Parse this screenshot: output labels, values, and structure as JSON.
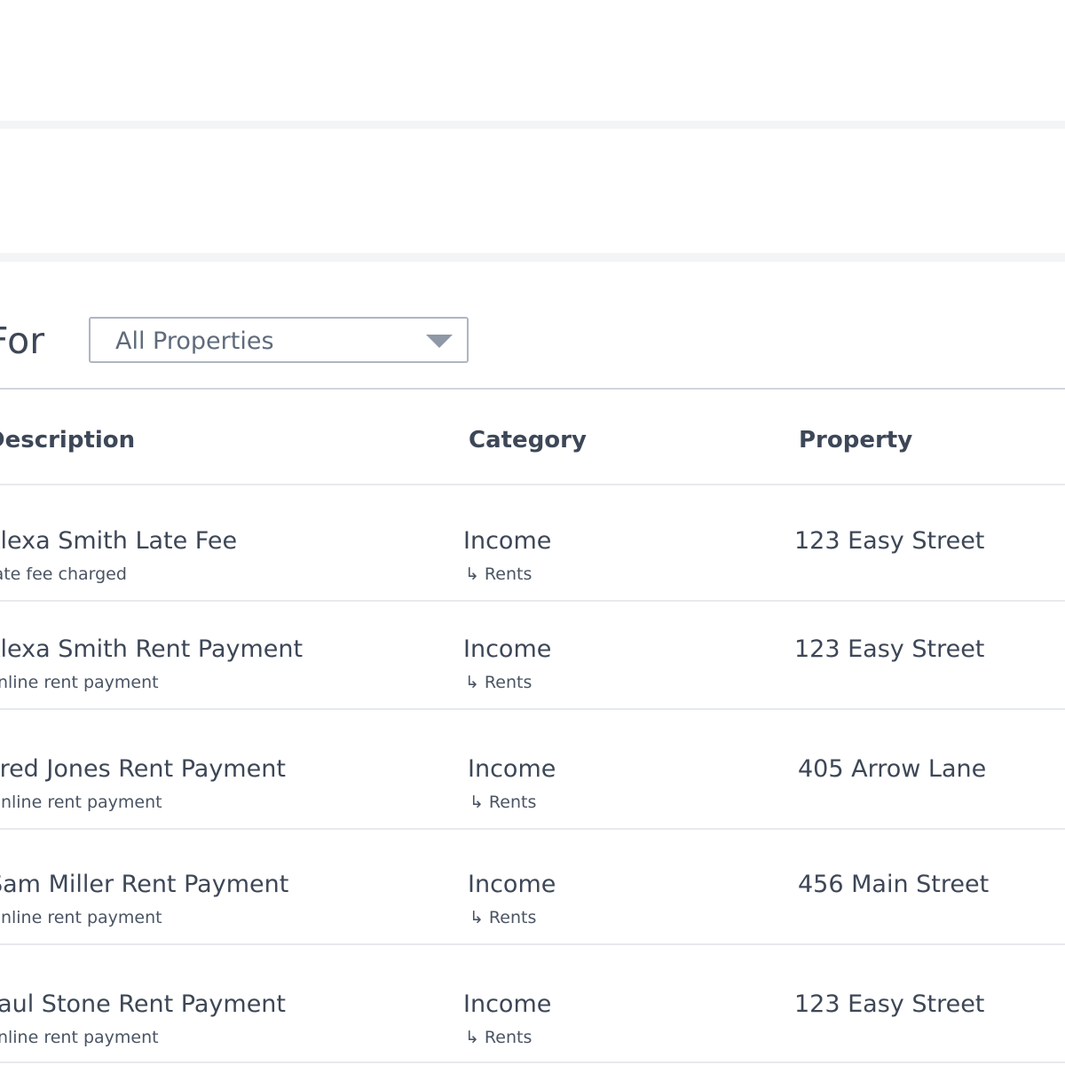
{
  "filter": {
    "label": "For",
    "select_value": "All Properties"
  },
  "table": {
    "headers": [
      "Description",
      "Category",
      "Property"
    ],
    "rows": [
      {
        "title": "Alexa Smith Late Fee",
        "subtitle": "Late fee charged",
        "category": "Income",
        "subcategory": "Rents",
        "property": "123 Easy Street"
      },
      {
        "title": "Alexa Smith Rent Payment",
        "subtitle": "Online rent payment",
        "category": "Income",
        "subcategory": "Rents",
        "property": "123 Easy Street"
      },
      {
        "title": "Fred Jones Rent Payment",
        "subtitle": "Online rent payment",
        "category": "Income",
        "subcategory": "Rents",
        "property": "405 Arrow Lane"
      },
      {
        "title": "Sam Miller Rent Payment",
        "subtitle": "Online rent payment",
        "category": "Income",
        "subcategory": "Rents",
        "property": "456 Main Street"
      },
      {
        "title": "Paul Stone Rent Payment",
        "subtitle": "Online rent payment",
        "category": "Income",
        "subcategory": "Rents",
        "property": "123 Easy Street"
      }
    ]
  },
  "icons": {
    "subcategory": "return-arrow-icon"
  },
  "colors": {
    "text": "#3d4757",
    "muted": "#5f6b7b",
    "border": "#aeb6c2",
    "band": "#f3f4f5"
  }
}
